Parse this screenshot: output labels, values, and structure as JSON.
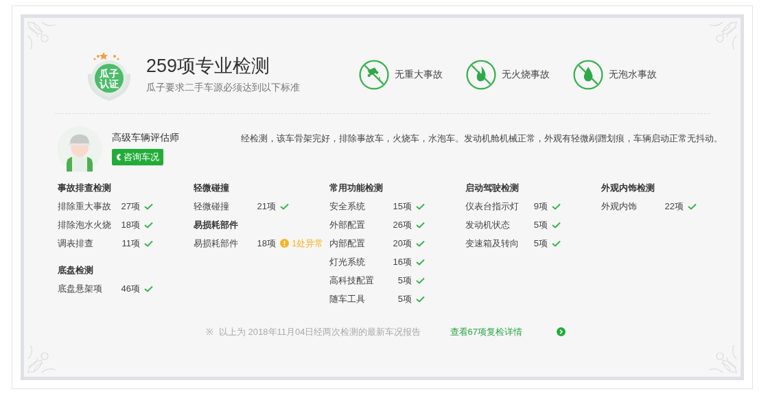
{
  "header": {
    "badge": "瓜子认证",
    "title": "259项专业检测",
    "subtitle": "瓜子要求二手车源必须达到以下标准",
    "guarantees": [
      {
        "kind": "crash",
        "label": "无重大事故"
      },
      {
        "kind": "fire",
        "label": "无火烧事故"
      },
      {
        "kind": "water",
        "label": "无泡水事故"
      }
    ]
  },
  "evaluator": {
    "title": "高级车辆评估师",
    "button": "咨询车况",
    "summary": "经检测，该车骨架完好，排除事故车，火烧车，水泡车。发动机舱机械正常，外观有轻微剐蹭划痕，车辆启动正常无抖动。"
  },
  "columns": [
    [
      {
        "title": "事故排查检测",
        "items": [
          {
            "name": "排除重大事故",
            "count": "27项",
            "passed": true
          },
          {
            "name": "排除泡水火烧",
            "count": "18项",
            "passed": true
          },
          {
            "name": "调表排查",
            "count": "11项",
            "passed": true
          }
        ]
      },
      {
        "title": "底盘检测",
        "items": [
          {
            "name": "底盘悬架项",
            "count": "46项",
            "passed": true
          }
        ]
      }
    ],
    [
      {
        "title": "轻微碰撞",
        "items": [
          {
            "name": "轻微碰撞",
            "count": "21项",
            "passed": true
          }
        ]
      },
      {
        "title": "易损耗部件",
        "items": [
          {
            "name": "易损耗部件",
            "count": "18项",
            "passed": false,
            "note": "1处异常"
          }
        ]
      }
    ],
    [
      {
        "title": "常用功能检测",
        "items": [
          {
            "name": "安全系统",
            "count": "15项",
            "passed": true
          },
          {
            "name": "外部配置",
            "count": "26项",
            "passed": true
          },
          {
            "name": "内部配置",
            "count": "20项",
            "passed": true
          },
          {
            "name": "灯光系统",
            "count": "16项",
            "passed": true
          },
          {
            "name": "高科技配置",
            "count": "5项",
            "passed": true
          },
          {
            "name": "随车工具",
            "count": "5项",
            "passed": true
          }
        ]
      }
    ],
    [
      {
        "title": "启动驾驶检测",
        "items": [
          {
            "name": "仪表台指示灯",
            "count": "9项",
            "passed": true
          },
          {
            "name": "发动机状态",
            "count": "5项",
            "passed": true
          },
          {
            "name": "变速箱及转向",
            "count": "5项",
            "passed": true
          }
        ]
      }
    ],
    [
      {
        "title": "外观内饰检测",
        "items": [
          {
            "name": "外观内饰",
            "count": "22项",
            "passed": true
          }
        ]
      }
    ]
  ],
  "footer": {
    "mark": "※",
    "note": "以上为 2018年11月04日经两次检测的最新车况报告",
    "link": "查看67项复检详情"
  }
}
